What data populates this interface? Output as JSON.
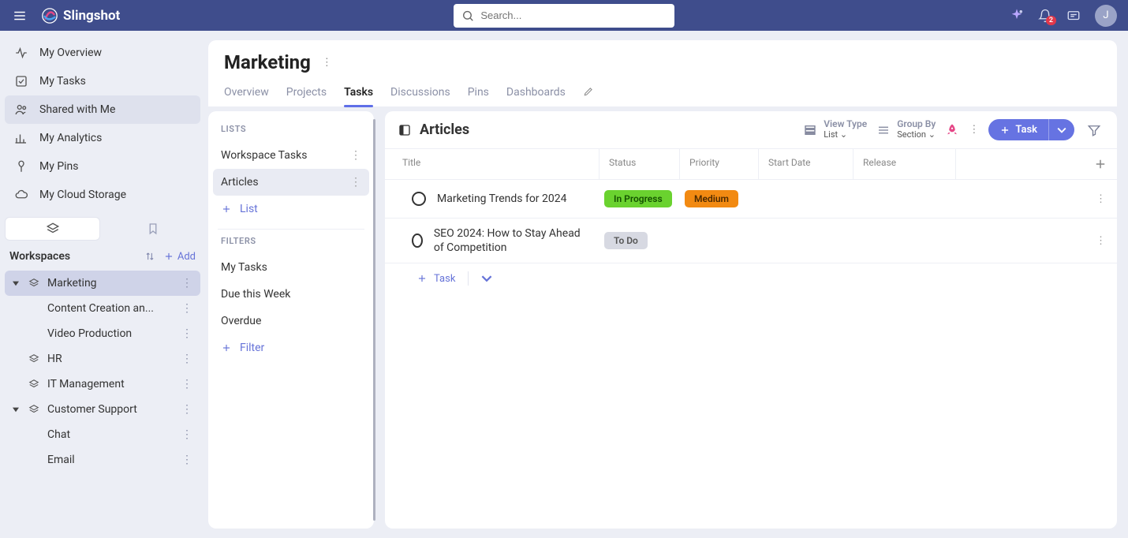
{
  "brand": {
    "name": "Slingshot"
  },
  "search": {
    "placeholder": "Search..."
  },
  "notifications": {
    "count": "2"
  },
  "avatar": {
    "initial": "J"
  },
  "sidebar": {
    "nav": [
      {
        "label": "My Overview"
      },
      {
        "label": "My Tasks"
      },
      {
        "label": "Shared with Me"
      },
      {
        "label": "My Analytics"
      },
      {
        "label": "My Pins"
      },
      {
        "label": "My Cloud Storage"
      }
    ],
    "workspaces_label": "Workspaces",
    "add_label": "Add",
    "tree": {
      "marketing": {
        "label": "Marketing"
      },
      "marketing_children": [
        {
          "label": "Content Creation an..."
        },
        {
          "label": "Video Production"
        }
      ],
      "hr": {
        "label": "HR"
      },
      "it": {
        "label": "IT Management"
      },
      "support": {
        "label": "Customer Support"
      },
      "support_children": [
        {
          "label": "Chat"
        },
        {
          "label": "Email"
        }
      ]
    }
  },
  "page": {
    "title": "Marketing",
    "tabs": [
      "Overview",
      "Projects",
      "Tasks",
      "Discussions",
      "Pins",
      "Dashboards"
    ]
  },
  "lists_panel": {
    "lists_label": "LISTS",
    "filters_label": "FILTERS",
    "lists": [
      {
        "label": "Workspace Tasks"
      },
      {
        "label": "Articles"
      }
    ],
    "add_list_label": "List",
    "filters": [
      {
        "label": "My Tasks"
      },
      {
        "label": "Due this Week"
      },
      {
        "label": "Overdue"
      }
    ],
    "add_filter_label": "Filter"
  },
  "tasks": {
    "list_title": "Articles",
    "view_type": {
      "label": "View Type",
      "value": "List"
    },
    "group_by": {
      "label": "Group By",
      "value": "Section"
    },
    "new_task_label": "Task",
    "add_task_label": "Task",
    "columns": {
      "title": "Title",
      "status": "Status",
      "priority": "Priority",
      "start": "Start Date",
      "release": "Release"
    },
    "rows": [
      {
        "title": "Marketing Trends for 2024",
        "status": "In Progress",
        "status_color": "green",
        "priority": "Medium",
        "priority_color": "orange"
      },
      {
        "title": "SEO 2024: How to Stay Ahead of Competition",
        "status": "To Do",
        "status_color": "grey",
        "priority": "",
        "priority_color": ""
      }
    ]
  }
}
